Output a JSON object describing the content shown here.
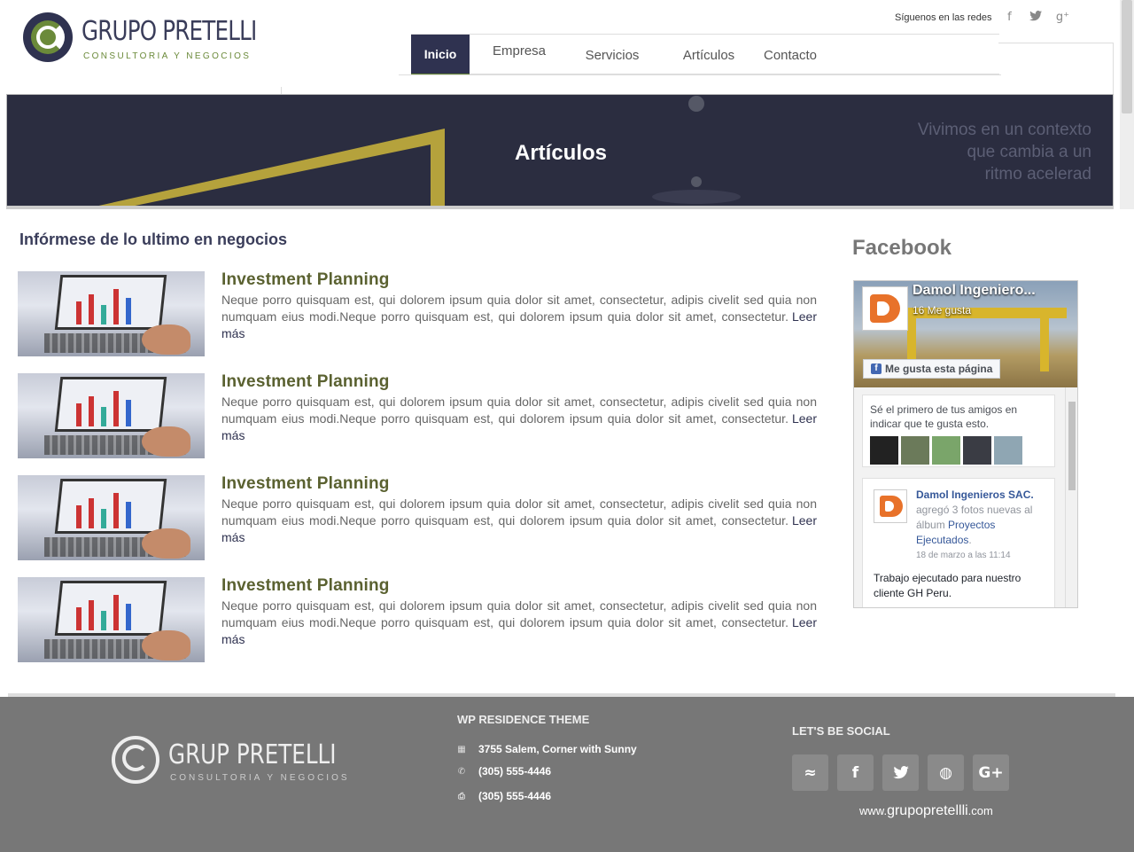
{
  "brand": {
    "name": "GRUPO PRETELLI",
    "tagline": "CONSULTORIA Y NEGOCIOS"
  },
  "topbar": {
    "follow_label": "Síguenos en las redes",
    "icons": [
      "facebook-icon",
      "twitter-icon",
      "google-plus-icon"
    ],
    "facebook_glyph": "f",
    "google_glyph": "g⁺"
  },
  "nav": {
    "items": [
      {
        "label": "Inicio",
        "active": true
      },
      {
        "label": "Empresa",
        "active": false
      },
      {
        "label": "Servicios",
        "active": false
      },
      {
        "label": "Artículos",
        "active": false
      },
      {
        "label": "Contacto",
        "active": false
      }
    ]
  },
  "banner": {
    "title": "Artículos",
    "quote_lines": [
      "Vivimos en un contexto",
      "que cambia a un",
      "ritmo acelerad"
    ]
  },
  "main": {
    "section_title": "Infórmese de lo ultimo en negocios",
    "articles": [
      {
        "title": "Investment Planning",
        "text": "Neque porro quisquam est, qui dolorem ipsum quia dolor sit amet, consectetur, adipis civelit sed quia non numquam eius modi.Neque porro quisquam est, qui dolorem ipsum quia dolor sit amet, consectetur.",
        "more": "Leer más"
      },
      {
        "title": "Investment Planning",
        "text": "Neque porro quisquam est, qui dolorem ipsum quia dolor sit amet, consectetur, adipis civelit sed quia non numquam eius modi.Neque porro quisquam est, qui dolorem ipsum quia dolor sit amet, consectetur.",
        "more": "Leer más"
      },
      {
        "title": "Investment Planning",
        "text": "Neque porro quisquam est, qui dolorem ipsum quia dolor sit amet, consectetur, adipis civelit sed quia non numquam eius modi.Neque porro quisquam est, qui dolorem ipsum quia dolor sit amet, consectetur.",
        "more": "Leer más"
      },
      {
        "title": "Investment Planning",
        "text": "Neque porro quisquam est, qui dolorem ipsum quia dolor sit amet, consectetur, adipis civelit sed quia non numquam eius modi.Neque porro quisquam est, qui dolorem ipsum quia dolor sit amet, consectetur.",
        "more": "Leer más"
      }
    ]
  },
  "facebook": {
    "heading": "Facebook",
    "page_name": "Damol Ingeniero...",
    "likes": "16 Me gusta",
    "like_button": "Me gusta esta página",
    "like_glyph": "f",
    "friends_text": "Sé el primero de tus amigos en indicar que te gusta esto.",
    "post": {
      "author": "Damol Ingenieros SAC.",
      "action": "agregó 3 fotos nuevas al álbum",
      "album": "Proyectos Ejecutados",
      "album_suffix": ".",
      "date": "18 de marzo a las 11:14",
      "body": "Trabajo ejecutado para nuestro cliente GH Peru."
    }
  },
  "footer": {
    "brand": "GRUP  PRETELLI",
    "brand_sub": "CONSULTORIA Y NEGOCIOS",
    "contact_title": "WP RESIDENCE THEME",
    "address": "3755 Salem, Corner with Sunny",
    "phone": "(305) 555-4446",
    "fax": "(305) 555-4446",
    "social_title": "LET'S BE SOCIAL",
    "social_icons": [
      "rss-icon",
      "facebook-icon",
      "twitter-icon",
      "dribbble-icon",
      "google-plus-icon"
    ],
    "social_glyphs": {
      "rss": "≈",
      "facebook": "f",
      "twitter": "✦",
      "dribbble": "◍",
      "google": "G+"
    },
    "url_prefix": "www.",
    "url_main": "grupopretellli",
    "url_suffix": ".com"
  },
  "colors": {
    "navy": "#2f3250",
    "olive": "#6b8a3a",
    "footer": "#777777"
  }
}
